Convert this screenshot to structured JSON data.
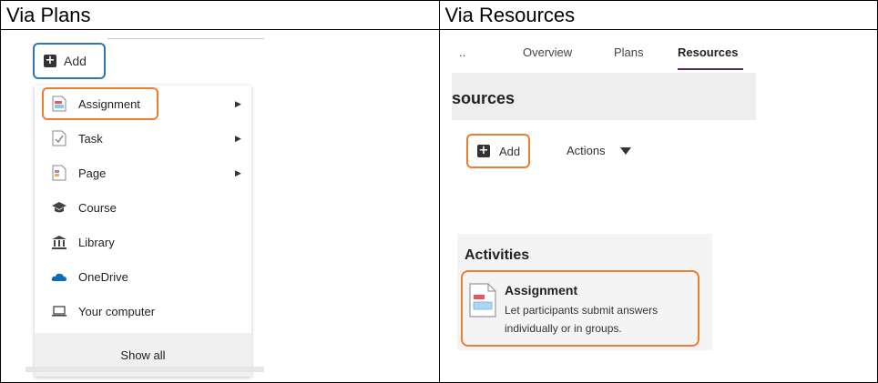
{
  "headers": {
    "left": "Via Plans",
    "right": "Via Resources"
  },
  "left_panel": {
    "add_label": "Add",
    "menu_items": [
      {
        "label": "Assignment",
        "icon": "assignment-icon",
        "submenu": true
      },
      {
        "label": "Task",
        "icon": "task-icon",
        "submenu": true
      },
      {
        "label": "Page",
        "icon": "page-icon",
        "submenu": true
      },
      {
        "label": "Course",
        "icon": "course-icon",
        "submenu": false
      },
      {
        "label": "Library",
        "icon": "library-icon",
        "submenu": false
      },
      {
        "label": "OneDrive",
        "icon": "onedrive-icon",
        "submenu": false
      },
      {
        "label": "Your computer",
        "icon": "computer-icon",
        "submenu": false
      }
    ],
    "show_all_label": "Show all"
  },
  "right_panel": {
    "tabs": {
      "ellipsis": "..",
      "overview": "Overview",
      "plans": "Plans",
      "resources": "Resources"
    },
    "page_title": "sources",
    "add_label": "Add",
    "actions_label": "Actions",
    "activities_title": "Activities",
    "assignment_title": "Assignment",
    "assignment_desc": "Let participants submit answers individually or in groups."
  },
  "colors": {
    "highlight_orange": "#ed7d31",
    "highlight_blue": "#2e75b6",
    "tab_underline": "#5a2a5a"
  }
}
